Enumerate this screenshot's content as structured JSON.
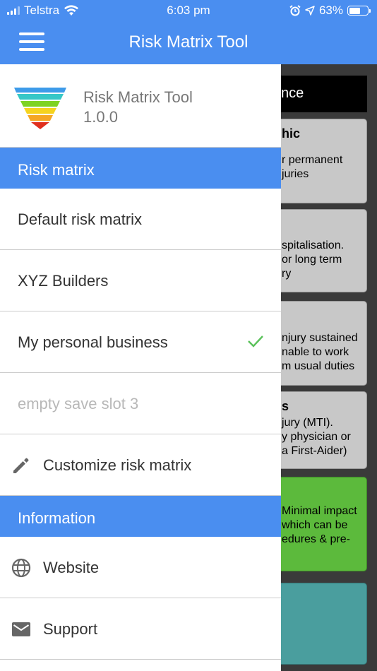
{
  "status_bar": {
    "carrier": "Telstra",
    "time": "6:03 pm",
    "battery": "63%",
    "battery_level": 0.63
  },
  "app_bar": {
    "title": "Risk Matrix Tool"
  },
  "drawer": {
    "app_name": "Risk Matrix Tool",
    "version": "1.0.0",
    "sections": [
      {
        "header": "Risk matrix",
        "items": [
          {
            "label": "Default risk matrix"
          },
          {
            "label": "XYZ Builders"
          },
          {
            "label": "My personal business",
            "selected": true
          },
          {
            "label": "empty save slot 3",
            "disabled": true
          },
          {
            "label": "Customize risk matrix",
            "icon": "pencil-icon"
          }
        ]
      },
      {
        "header": "Information",
        "items": [
          {
            "label": "Website",
            "icon": "globe-icon"
          },
          {
            "label": "Support",
            "icon": "mail-icon"
          }
        ]
      }
    ]
  },
  "background": {
    "header": "nce",
    "cards": [
      {
        "title": "hic",
        "lines": [
          "r permanent",
          "juries"
        ]
      },
      {
        "lines": [
          "spitalisation.",
          "or long term",
          "ry"
        ]
      },
      {
        "lines": [
          "njury sustained",
          "nable to work",
          "m usual duties"
        ]
      },
      {
        "title": "s",
        "lines": [
          "jury (MTI).",
          "y physician or",
          "a First-Aider)"
        ]
      },
      {
        "lines": [
          "Minimal impact",
          "which can be",
          "edures & pre-"
        ]
      },
      {
        "lines": []
      }
    ]
  },
  "colors": {
    "accent": "#4a8ef0",
    "check": "#5cc25c",
    "card_green": "#5cba3c",
    "card_teal": "#4a9e9e",
    "card_grey": "#c8c8c8"
  }
}
